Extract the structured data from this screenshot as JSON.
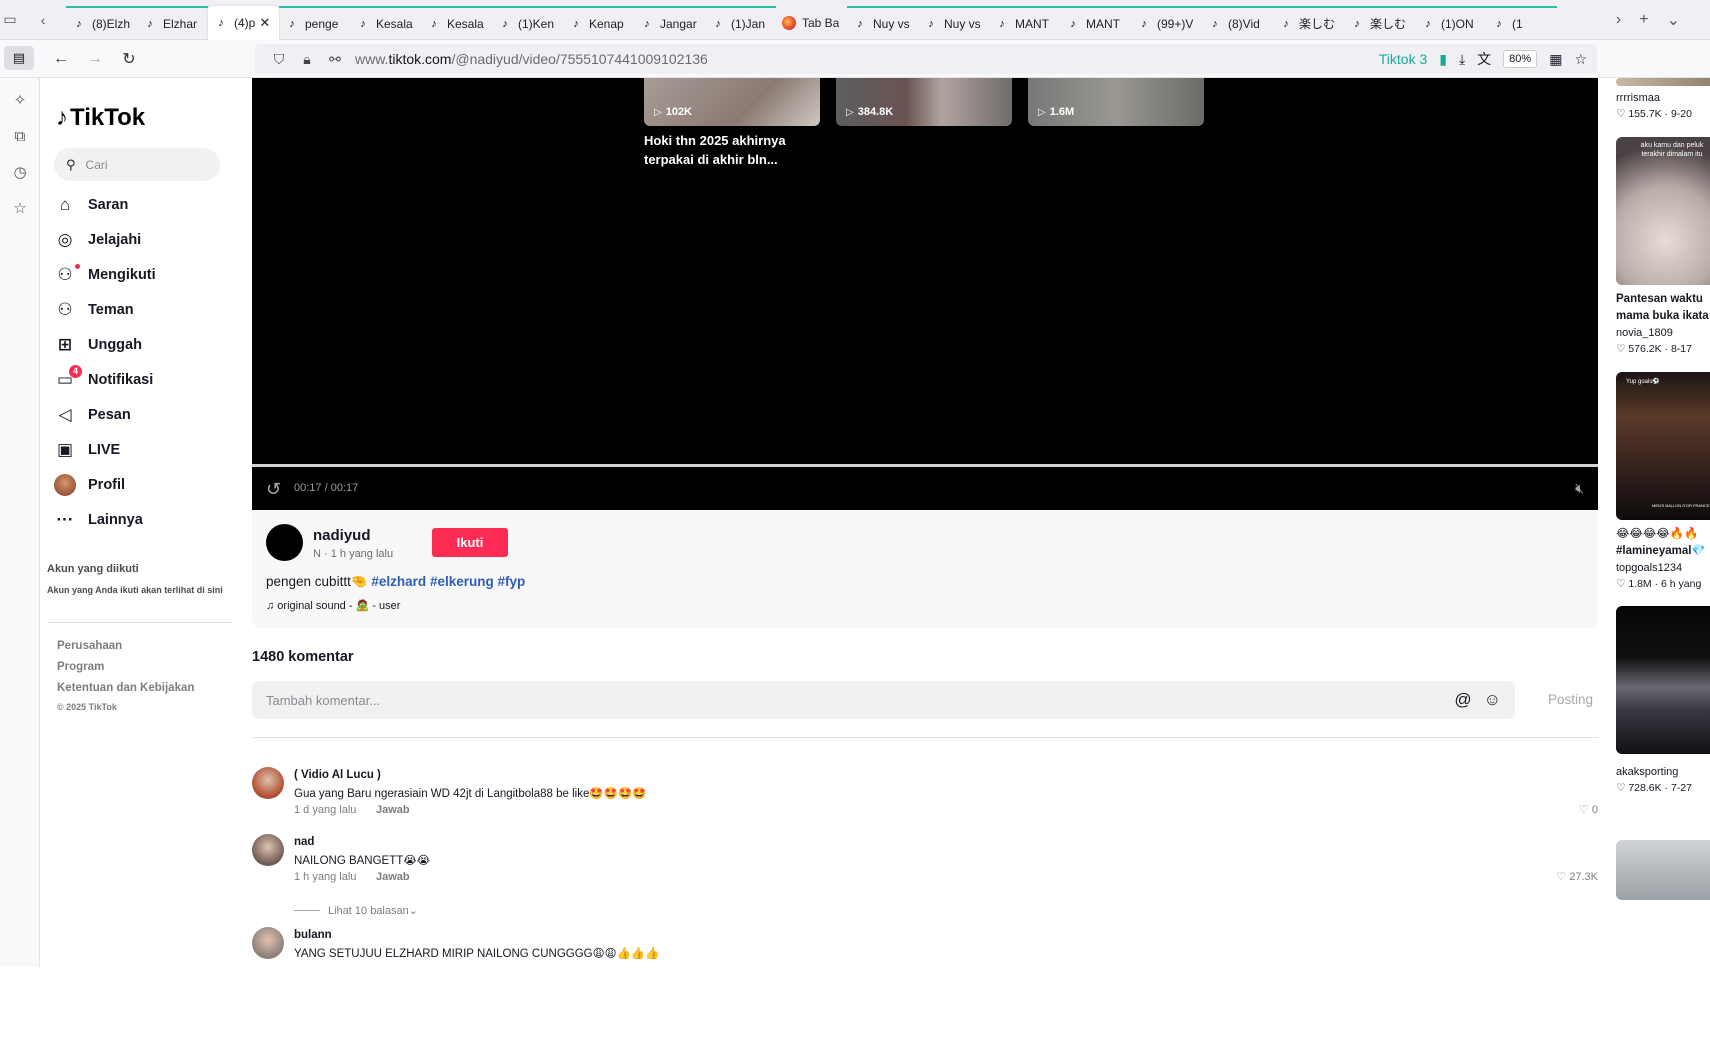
{
  "browser": {
    "tabs": [
      {
        "label": "(8)Elzh",
        "icon": "tiktok"
      },
      {
        "label": "Elzhar",
        "icon": "tiktok"
      },
      {
        "label": "(4)p",
        "icon": "tiktok",
        "active": true
      },
      {
        "label": "penge",
        "icon": "tiktok"
      },
      {
        "label": "Kesala",
        "icon": "tiktok"
      },
      {
        "label": "Kesala",
        "icon": "tiktok"
      },
      {
        "label": "(1)Ken",
        "icon": "tiktok"
      },
      {
        "label": "Kenap",
        "icon": "tiktok"
      },
      {
        "label": "Jangar",
        "icon": "tiktok"
      },
      {
        "label": "(1)Jan",
        "icon": "tiktok"
      },
      {
        "label": "Tab Ba",
        "icon": "firefox"
      },
      {
        "label": "Nuy vs",
        "icon": "tiktok"
      },
      {
        "label": "Nuy vs",
        "icon": "tiktok"
      },
      {
        "label": "MANT",
        "icon": "tiktok"
      },
      {
        "label": "MANT",
        "icon": "tiktok"
      },
      {
        "label": "(99+)V",
        "icon": "tiktok"
      },
      {
        "label": "(8)Vid",
        "icon": "tiktok"
      },
      {
        "label": "楽しむ",
        "icon": "tiktok"
      },
      {
        "label": "楽しむ",
        "icon": "tiktok"
      },
      {
        "label": "(1)ON",
        "icon": "tiktok"
      },
      {
        "label": "(1",
        "icon": "tiktok"
      }
    ],
    "url_prefix": "www.",
    "url_domain": "tiktok.com",
    "url_path": "/@nadiyud/video/7555107441009102136",
    "extension_label": "Tiktok 3",
    "zoom": "80%"
  },
  "nav": {
    "logo": "TikTok",
    "search_placeholder": "Cari",
    "items": [
      {
        "label": "Saran",
        "icon": "home-icon"
      },
      {
        "label": "Jelajahi",
        "icon": "compass-icon"
      },
      {
        "label": "Mengikuti",
        "icon": "following-icon"
      },
      {
        "label": "Teman",
        "icon": "friends-icon"
      },
      {
        "label": "Unggah",
        "icon": "upload-icon"
      },
      {
        "label": "Notifikasi",
        "icon": "notification-icon",
        "badge": "4"
      },
      {
        "label": "Pesan",
        "icon": "message-icon"
      },
      {
        "label": "LIVE",
        "icon": "live-icon"
      },
      {
        "label": "Profil",
        "icon": "profile-avatar"
      },
      {
        "label": "Lainnya",
        "icon": "more-icon"
      }
    ],
    "following_title": "Akun yang diikuti",
    "following_desc": "Akun yang Anda ikuti akan terlihat di sini",
    "footer_links": [
      "Perusahaan",
      "Program",
      "Ketentuan dan Kebijakan"
    ],
    "copyright": "© 2025 TikTok"
  },
  "video": {
    "thumbs": [
      {
        "views": "102K"
      },
      {
        "views": "384.8K"
      },
      {
        "views": "1.6M"
      }
    ],
    "thumb_title": "Hoki thn 2025 akhirnya terpakai di akhir bln...",
    "time": "00:17 / 00:17",
    "progress": 1.0
  },
  "post": {
    "author": "nadiyud",
    "meta": "N · 1 h yang lalu",
    "follow_label": "Ikuti",
    "caption_text": "pengen cubittt🤏",
    "hashtags": [
      "#elzhard",
      "#elkerung",
      "#fyp"
    ],
    "music": "♫ original sound - 🧟 - user"
  },
  "comments": {
    "count_label": "1480 komentar",
    "input_placeholder": "Tambah komentar...",
    "post_label": "Posting",
    "items": [
      {
        "user": "( Vidio Al Lucu )",
        "text": "Gua yang Baru ngerasiain WD 42jt di Langitbola88 be like🤩🤩🤩🤩",
        "time": "1 d yang lalu",
        "reply": "Jawab",
        "likes": "0",
        "avatar": "#b04a2c"
      },
      {
        "user": "nad",
        "text": "NAILONG BANGETT😭😭",
        "time": "1 h yang lalu",
        "reply": "Jawab",
        "likes": "27.3K",
        "replies": "Lihat 10 balasan",
        "avatar": "#6d5a55"
      },
      {
        "user": "bulann",
        "text": "YANG SETUJUU ELZHARD MIRIP NAILONG CUNGGGG😩😩👍👍👍",
        "avatar": "#8a7f7a"
      }
    ]
  },
  "recommendations": [
    {
      "user": "rrrrismaa",
      "stats": "♡ 155.7K · 9-20"
    },
    {
      "title1": "Pantesan waktu",
      "title2": "mama buka ikata",
      "user": "novia_1809",
      "stats": "♡ 576.2K · 8-17",
      "overlay": "aku kamu dan peluk terakhir dimalam itu"
    },
    {
      "title1": "😂😂😂😂🔥🔥",
      "title2": "#lamineyamal💎",
      "user": "topgoals1234",
      "stats": "♡ 1.8M · 6 h yang",
      "overlay": "Yup goals⚽",
      "banner": "MEN'S BALLON D'OR FRANCE"
    },
    {
      "user": "akaksporting",
      "stats": "♡ 728.6K · 7-27"
    }
  ]
}
